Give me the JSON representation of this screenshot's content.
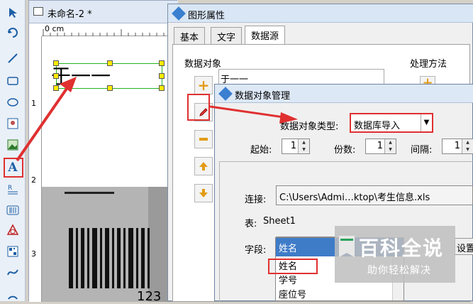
{
  "document": {
    "tab_title": "未命名-2 *",
    "ruler_unit": "0 cm",
    "ruler_left_marks": [
      "1",
      "2",
      "3"
    ],
    "text_object": "于一一",
    "barcode_digits": "123"
  },
  "toolbar": {
    "icons": [
      "select-arrow-icon",
      "rotate-icon",
      "line-icon",
      "rectangle-icon",
      "ellipse-icon",
      "image-icon",
      "picture-icon",
      "text-icon",
      "rich-text-icon",
      "barcode-icon",
      "qrcode-icon",
      "shape-icon",
      "curve-icon",
      "arc-icon"
    ]
  },
  "properties_dialog": {
    "title": "图形属性",
    "tabs": [
      "基本",
      "文字",
      "数据源"
    ],
    "active_tab": "数据源",
    "data_objects_label": "数据对象",
    "data_object_item": "于一一",
    "processing_label": "处理方法"
  },
  "data_object_dialog": {
    "title": "数据对象管理",
    "type_label": "数据对象类型:",
    "type_value": "数据库导入",
    "start_label": "起始:",
    "start_value": "1",
    "copies_label": "份数:",
    "copies_value": "1",
    "interval_label": "间隔:",
    "interval_value": "1",
    "connection_label": "连接:",
    "connection_value": "C:\\Users\\Admi…ktop\\考生信息.xls",
    "table_label": "表:",
    "table_value": "Sheet1",
    "field_label": "字段:",
    "field_value": "姓名",
    "field_options": [
      "姓名",
      "学号",
      "座位号"
    ],
    "settings_button": "设置"
  },
  "watermark": {
    "title": "百科全说",
    "subtitle": "助你轻松解决"
  },
  "colors": {
    "highlight": "#e03030",
    "selection": "#21b421",
    "handle": "#ffea00"
  }
}
